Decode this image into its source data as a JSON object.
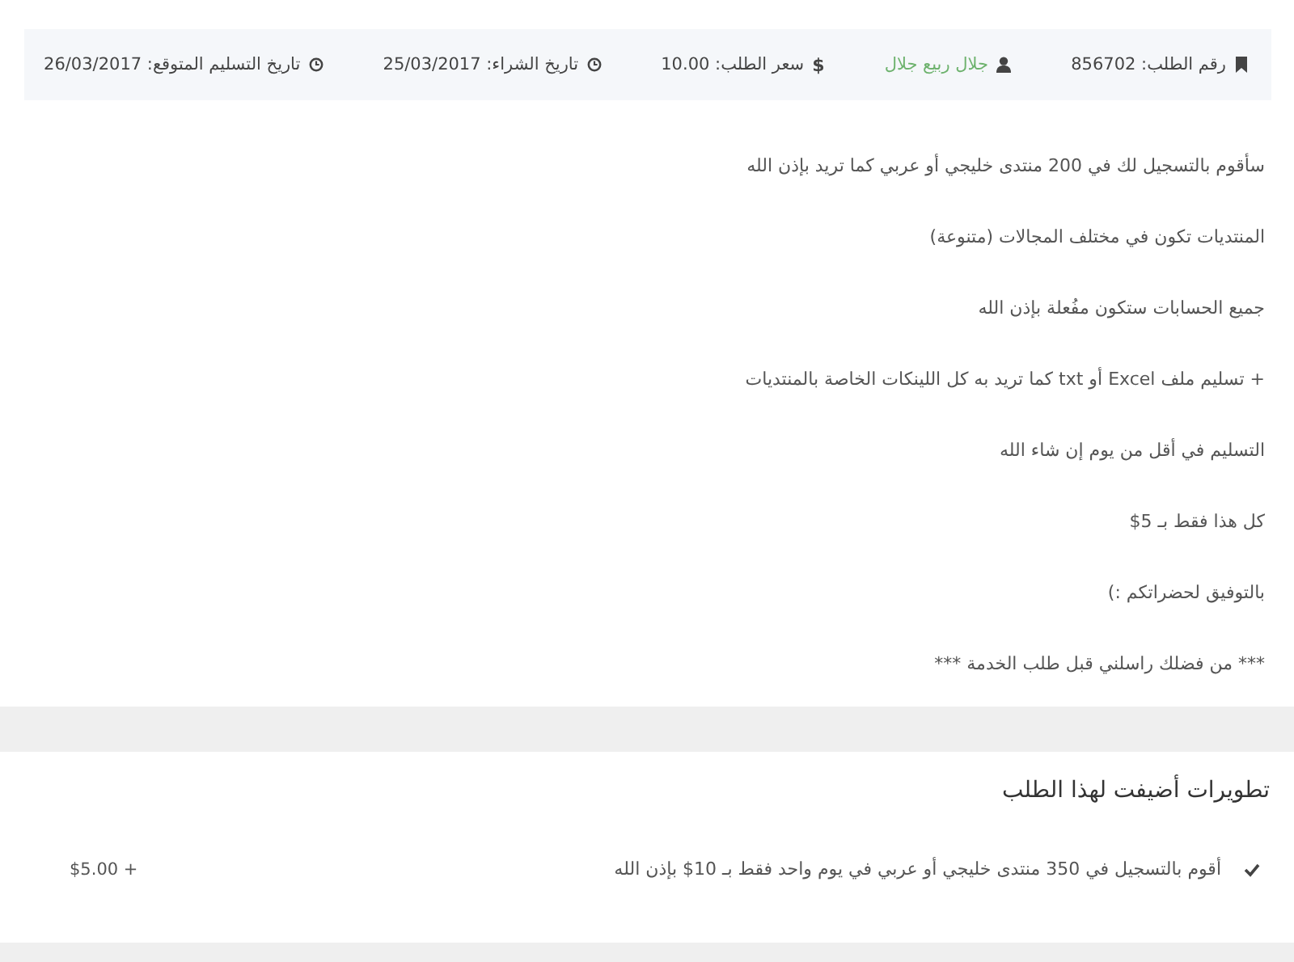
{
  "order_meta": [
    {
      "kind": "bookmark",
      "text": "رقم الطلب: 856702",
      "highlight": false
    },
    {
      "kind": "user",
      "text": "جلال ربيع جلال",
      "highlight": true
    },
    {
      "kind": "dollar",
      "symbol": "$",
      "text": "سعر الطلب: 10.00",
      "highlight": false
    },
    {
      "kind": "clock",
      "text": "تاريخ الشراء: 25/03/2017",
      "highlight": false
    },
    {
      "kind": "clock",
      "text": "تاريخ التسليم المتوقع: 26/03/2017",
      "highlight": false
    }
  ],
  "description": [
    "سأقوم بالتسجيل لك في 200 منتدى خليجي أو عربي كما تريد بإذن الله",
    "المنتديات تكون في مختلف المجالات (متنوعة)",
    "جميع الحسابات ستكون مفُعلة بإذن الله",
    "+ تسليم ملف Excel أو txt كما تريد به كل اللينكات الخاصة بالمنتديات",
    "التسليم في أقل من يوم إن شاء الله",
    "كل هذا فقط بـ 5$",
    "بالتوفيق لحضراتكم :)",
    "*** من فضلك راسلني قبل طلب الخدمة ***"
  ],
  "extras": {
    "title": "تطويرات أضيفت لهذا الطلب",
    "items": [
      {
        "checked": true,
        "text": "أقوم بالتسجيل في 350 منتدى خليجي أو عربي في يوم واحد فقط بـ 10$ بإذن الله",
        "price": "$5.00 +"
      }
    ]
  }
}
